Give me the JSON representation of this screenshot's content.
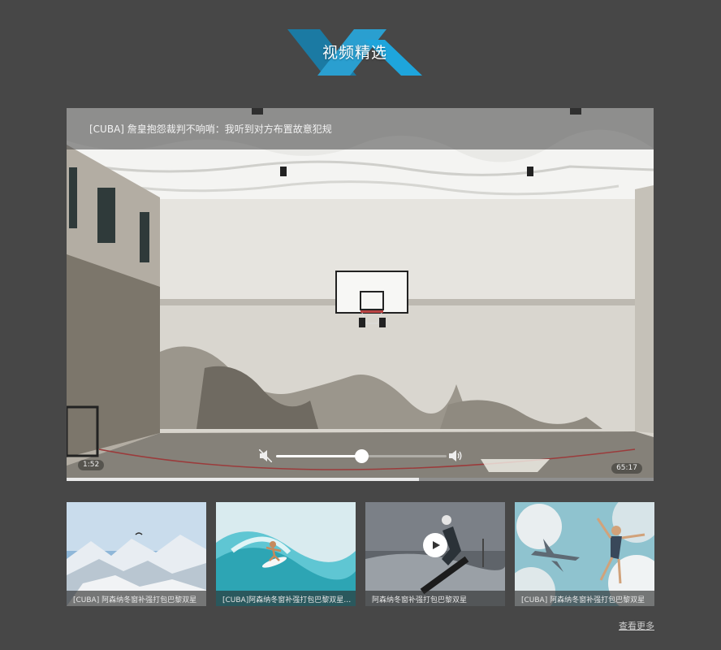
{
  "section": {
    "title": "视频精选",
    "accent_dark": "#1b89b5",
    "accent_light": "#2eb3e6"
  },
  "player": {
    "title": "[CUBA] 詹皇抱怨裁判不响哨：我听到对方布置故意犯规",
    "current_time": "1:52",
    "duration": "65:17",
    "volume_fraction": 0.5,
    "progress_fraction": 0.6,
    "mute_icon": "volume-mute-icon",
    "volume_icon": "volume-high-icon"
  },
  "thumbnails": [
    {
      "caption": "[CUBA] 阿森纳冬窗补强打包巴黎双星",
      "scene": "snow-mountains-paraglider"
    },
    {
      "caption": "[CUBA]阿森纳冬窗补强打包巴黎双星什么...",
      "scene": "surfer-wave"
    },
    {
      "caption": "阿森纳冬窗补强打包巴黎双星",
      "scene": "snowboarder",
      "has_play_button": true
    },
    {
      "caption": "[CUBA] 阿森纳冬窗补强打包巴黎双星",
      "scene": "skydiver-airplane"
    }
  ],
  "more_link": "查看更多"
}
